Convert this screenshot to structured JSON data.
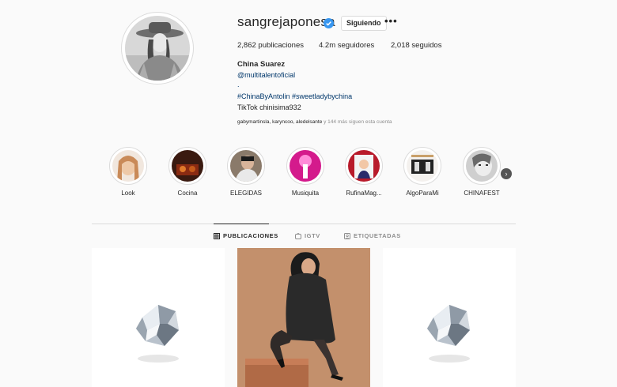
{
  "profile": {
    "username": "sangrejaponesa",
    "follow_label": "Siguiendo",
    "more_label": "•••",
    "stats": {
      "posts_value": "2,862",
      "posts_label": "publicaciones",
      "followers_value": "4.2m",
      "followers_label": "seguidores",
      "following_value": "2,018",
      "following_label": "seguidos"
    },
    "full_name": "China Suarez",
    "bio_link": "@multitalentoficial",
    "bio_dot": ".",
    "bio_tags": "#ChinaByAntolin #sweetladybychina",
    "bio_tiktok": "TikTok chinisima932",
    "followed_by_names": "gabymartinsla, karyncoo, aledelsante",
    "followed_by_rest": "y 144 más siguen esta cuenta"
  },
  "highlights": [
    {
      "label": "Look"
    },
    {
      "label": "Cocina"
    },
    {
      "label": "ELEGIDAS"
    },
    {
      "label": "Musiquita"
    },
    {
      "label": "RufinaMag..."
    },
    {
      "label": "AlgoParaMi"
    },
    {
      "label": "CHINAFEST"
    }
  ],
  "tabs": {
    "posts": "PUBLICACIONES",
    "igtv": "IGTV",
    "tagged": "ETIQUETADAS"
  },
  "colors": {
    "background": "#fafafa",
    "link": "#00376b",
    "verified": "#3897f0",
    "border": "#dbdbdb",
    "muted": "#8e8e8e"
  },
  "icons": {
    "verified": "verified-badge-icon",
    "more": "more-options-icon",
    "next": "chevron-right-icon",
    "posts_tab": "grid-icon",
    "igtv_tab": "igtv-icon",
    "tagged_tab": "tagged-icon"
  }
}
